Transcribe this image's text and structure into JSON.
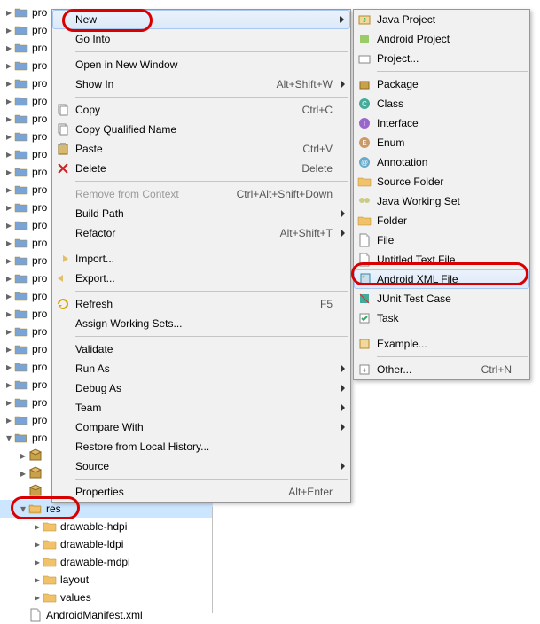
{
  "tree": {
    "proj_label": "pro",
    "expanded_label": "pro",
    "res_label": "res",
    "subfolders": [
      "drawable-hdpi",
      "drawable-ldpi",
      "drawable-mdpi",
      "layout",
      "values"
    ],
    "manifest": "AndroidManifest.xml",
    "pkg_rows": 2
  },
  "main_menu": [
    {
      "icon": "",
      "label": "New",
      "sub": true,
      "highlight": true
    },
    {
      "label": "Go Into"
    },
    {
      "sep": true
    },
    {
      "label": "Open in New Window"
    },
    {
      "label": "Show In",
      "accel": "Alt+Shift+W",
      "sub": true
    },
    {
      "sep": true
    },
    {
      "icon": "copy",
      "label": "Copy",
      "accel": "Ctrl+C"
    },
    {
      "icon": "copyq",
      "label": "Copy Qualified Name"
    },
    {
      "icon": "paste",
      "label": "Paste",
      "accel": "Ctrl+V"
    },
    {
      "icon": "delete",
      "label": "Delete",
      "accel": "Delete"
    },
    {
      "sep": true
    },
    {
      "label": "Remove from Context",
      "accel": "Ctrl+Alt+Shift+Down",
      "disabled": true
    },
    {
      "label": "Build Path",
      "sub": true
    },
    {
      "label": "Refactor",
      "accel": "Alt+Shift+T",
      "sub": true
    },
    {
      "sep": true
    },
    {
      "icon": "import",
      "label": "Import..."
    },
    {
      "icon": "export",
      "label": "Export..."
    },
    {
      "sep": true
    },
    {
      "icon": "refresh",
      "label": "Refresh",
      "accel": "F5"
    },
    {
      "label": "Assign Working Sets..."
    },
    {
      "sep": true
    },
    {
      "label": "Validate"
    },
    {
      "label": "Run As",
      "sub": true
    },
    {
      "label": "Debug As",
      "sub": true
    },
    {
      "label": "Team",
      "sub": true
    },
    {
      "label": "Compare With",
      "sub": true
    },
    {
      "label": "Restore from Local History..."
    },
    {
      "label": "Source",
      "sub": true
    },
    {
      "sep": true
    },
    {
      "label": "Properties",
      "accel": "Alt+Enter"
    }
  ],
  "sub_menu": [
    {
      "icon": "javaproj",
      "label": "Java Project"
    },
    {
      "icon": "androidproj",
      "label": "Android Project"
    },
    {
      "icon": "project",
      "label": "Project..."
    },
    {
      "sep": true
    },
    {
      "icon": "package",
      "label": "Package"
    },
    {
      "icon": "class",
      "label": "Class"
    },
    {
      "icon": "interface",
      "label": "Interface"
    },
    {
      "icon": "enum",
      "label": "Enum"
    },
    {
      "icon": "annotation",
      "label": "Annotation"
    },
    {
      "icon": "srcfolder",
      "label": "Source Folder"
    },
    {
      "icon": "workingset",
      "label": "Java Working Set"
    },
    {
      "icon": "folder",
      "label": "Folder"
    },
    {
      "icon": "file",
      "label": "File"
    },
    {
      "icon": "textfile",
      "label": "Untitled Text File"
    },
    {
      "icon": "androidxml",
      "label": "Android XML File",
      "highlight": true
    },
    {
      "icon": "junit",
      "label": "JUnit Test Case"
    },
    {
      "icon": "task",
      "label": "Task"
    },
    {
      "sep": true
    },
    {
      "icon": "example",
      "label": "Example..."
    },
    {
      "sep": true
    },
    {
      "icon": "other",
      "label": "Other...",
      "accel": "Ctrl+N"
    }
  ]
}
